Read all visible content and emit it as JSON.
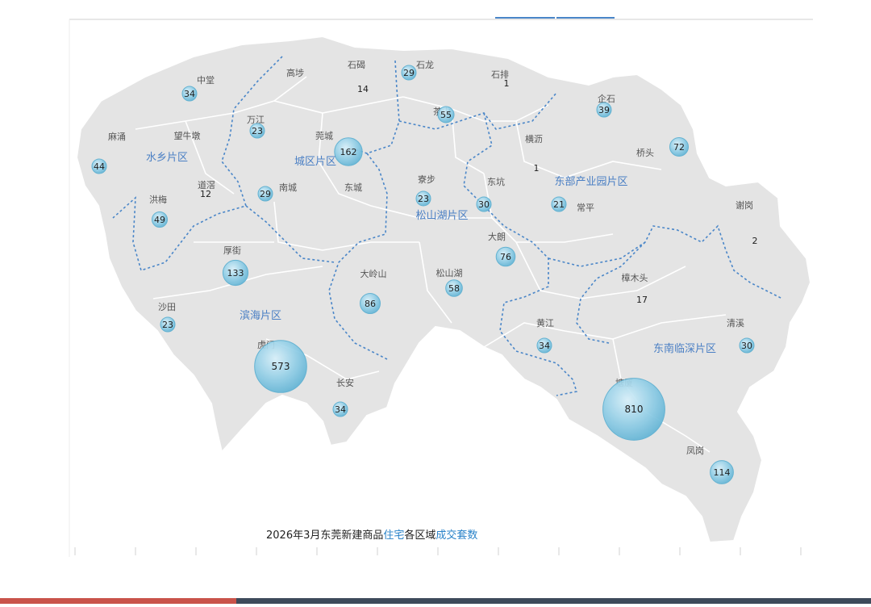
{
  "map": {
    "caption": [
      {
        "text": "2026年3月东莞新建商品",
        "color": "#222222"
      },
      {
        "text": "住宅",
        "color": "#2a83c9"
      },
      {
        "text": "各区域",
        "color": "#222222"
      },
      {
        "text": "成交套数",
        "color": "#2a83c9"
      }
    ],
    "colors": {
      "land": "#e4e4e4",
      "border": "#ffffff",
      "zone_line": "#4a86c8",
      "bubble": "#8fcde6",
      "bubble_edge": "#5aaed0"
    },
    "zones": [
      {
        "name": "水乡片区"
      },
      {
        "name": "城区片区"
      },
      {
        "name": "松山湖片区"
      },
      {
        "name": "东部产业园片区"
      },
      {
        "name": "滨海片区"
      },
      {
        "name": "东南临深片区"
      }
    ],
    "towns": [
      {
        "name": "中堂",
        "count": 34
      },
      {
        "name": "高埗",
        "count": null
      },
      {
        "name": "石碣",
        "count": 14
      },
      {
        "name": "石龙",
        "count": 29
      },
      {
        "name": "石排",
        "count": 1
      },
      {
        "name": "企石",
        "count": 39
      },
      {
        "name": "麻涌",
        "count": 44
      },
      {
        "name": "望牛墩",
        "count": null
      },
      {
        "name": "万江",
        "count": 23
      },
      {
        "name": "莞城",
        "count": 162
      },
      {
        "name": "茶山",
        "count": 55
      },
      {
        "name": "横沥",
        "count": 1
      },
      {
        "name": "桥头",
        "count": 72
      },
      {
        "name": "道滘",
        "count": 12
      },
      {
        "name": "南城",
        "count": 29
      },
      {
        "name": "东城",
        "count": null
      },
      {
        "name": "寮步",
        "count": 23
      },
      {
        "name": "东坑",
        "count": 30
      },
      {
        "name": "常平",
        "count": 21
      },
      {
        "name": "洪梅",
        "count": 49
      },
      {
        "name": "谢岗",
        "count": 2
      },
      {
        "name": "厚街",
        "count": 133
      },
      {
        "name": "大朗",
        "count": 76
      },
      {
        "name": "大岭山",
        "count": 86
      },
      {
        "name": "松山湖",
        "count": 58
      },
      {
        "name": "樟木头",
        "count": 17
      },
      {
        "name": "沙田",
        "count": 23
      },
      {
        "name": "黄江",
        "count": 34
      },
      {
        "name": "清溪",
        "count": 30
      },
      {
        "name": "虎门",
        "count": 573
      },
      {
        "name": "长安",
        "count": 34
      },
      {
        "name": "塘厦",
        "count": 810
      },
      {
        "name": "凤岗",
        "count": 114
      }
    ]
  }
}
